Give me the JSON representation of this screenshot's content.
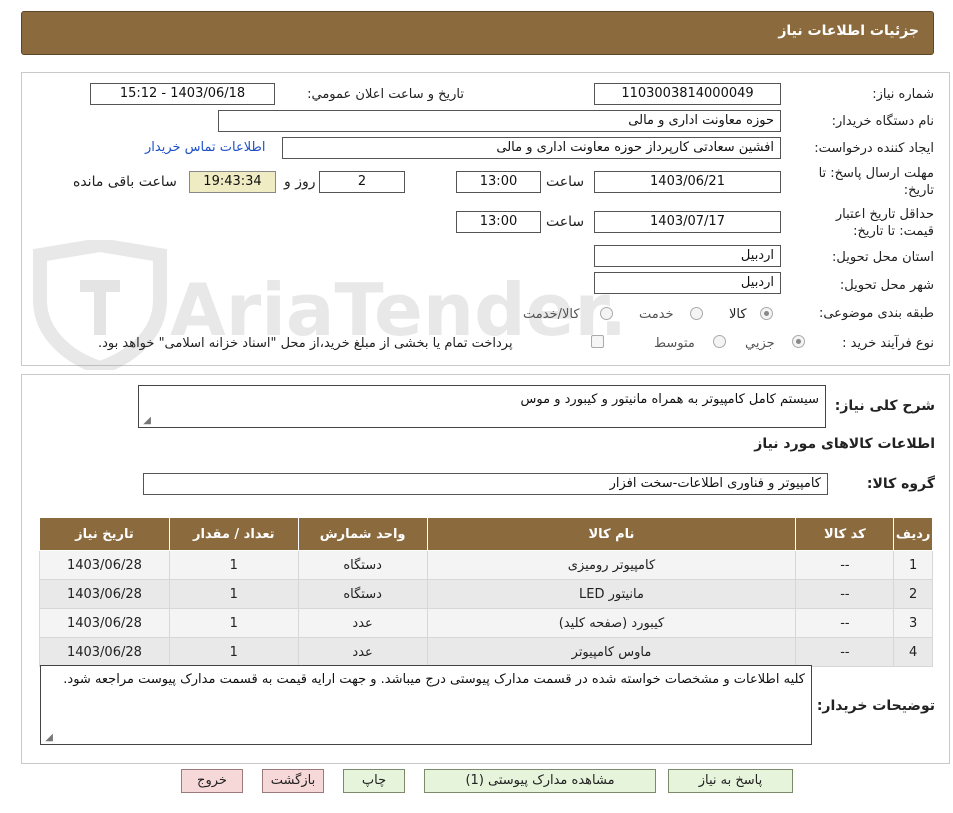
{
  "header": {
    "title": "جزئیات اطلاعات نیاز"
  },
  "form": {
    "need_number": {
      "label": "شماره نیاز:",
      "value": "1103003814000049"
    },
    "announce_date": {
      "label": "تاریخ و ساعت اعلان عمومي:",
      "value": "1403/06/18 - 15:12"
    },
    "buyer_org": {
      "label": "نام دستگاه خريدار:",
      "value": "حوزه معاونت اداری و مالی"
    },
    "requester": {
      "label": "ايجاد کننده درخواست:",
      "value": "افشین سعادتی کارپرداز حوزه معاونت اداری و مالی"
    },
    "contact_link": "اطلاعات تماس خريدار",
    "send_deadline": {
      "label_line1": "مهلت ارسال پاسخ: تا",
      "label_line2": "تاريخ:",
      "date": "1403/06/21",
      "time_label": "ساعت",
      "time": "13:00",
      "days": "2",
      "days_label": "روز و",
      "remaining": "19:43:34",
      "remaining_label": "ساعت باقی مانده"
    },
    "price_validity": {
      "label_line1": "حداقل تاريخ اعتبار",
      "label_line2": "قيمت: تا تاريخ:",
      "date": "1403/07/17",
      "time_label": "ساعت",
      "time": "13:00"
    },
    "province": {
      "label": "استان محل تحويل:",
      "value": "اردبیل"
    },
    "city": {
      "label": "شهر محل تحويل:",
      "value": "اردبیل"
    },
    "category": {
      "label": "طبقه بندی موضوعی:",
      "options": [
        "کالا",
        "خدمت",
        "کالا/خدمت"
      ],
      "selected": "کالا"
    },
    "purchase_type": {
      "label": "نوع فرآيند خريد :",
      "options": [
        "جزيي",
        "متوسط"
      ],
      "selected": "جزيي",
      "note": "پرداخت تمام يا بخشی از مبلغ خريد،از محل \"اسناد خزانه اسلامی\" خواهد بود."
    }
  },
  "need": {
    "summary_label": "شرح کلی نياز:",
    "summary": "سیستم کامل کامپیوتر به همراه مانیتور و کیبورد و موس",
    "goods_title": "اطلاعات کالاهای مورد نياز",
    "group_label": "گروه کالا:",
    "group": "کامپیوتر و فناوری اطلاعات-سخت افزار"
  },
  "table": {
    "headers": [
      "رديف",
      "کد کالا",
      "نام کالا",
      "واحد شمارش",
      "تعداد / مقدار",
      "تاريخ نياز"
    ],
    "rows": [
      {
        "index": "1",
        "code": "--",
        "name": "کامپیوتر رومیزی",
        "unit": "دستگاه",
        "qty": "1",
        "date": "1403/06/28"
      },
      {
        "index": "2",
        "code": "--",
        "name": "مانیتور LED",
        "unit": "دستگاه",
        "qty": "1",
        "date": "1403/06/28"
      },
      {
        "index": "3",
        "code": "--",
        "name": "کیبورد (صفحه کلید)",
        "unit": "عدد",
        "qty": "1",
        "date": "1403/06/28"
      },
      {
        "index": "4",
        "code": "--",
        "name": "ماوس کامپیوتر",
        "unit": "عدد",
        "qty": "1",
        "date": "1403/06/28"
      }
    ]
  },
  "buyer_notes": {
    "label": "توضيحات خريدار:",
    "text": "کلیه اطلاعات و مشخصات خواسته شده در قسمت مدارک پیوستی درج میباشد. و جهت ارایه قیمت به قسمت مدارک پیوست مراجعه شود."
  },
  "buttons": {
    "reply": "پاسخ به نياز",
    "attachments": "مشاهده مدارک پيوستی (1)",
    "print": "چاپ",
    "back": "بازگشت",
    "exit": "خروج"
  },
  "watermark": {
    "text": "AriaTender.neT"
  },
  "colors": {
    "header": "#8b6a3e",
    "buttons": "#e6f4dc",
    "danger_buttons": "#f6d8d8",
    "highlight": "#efecc4",
    "link": "#1e50c8"
  }
}
